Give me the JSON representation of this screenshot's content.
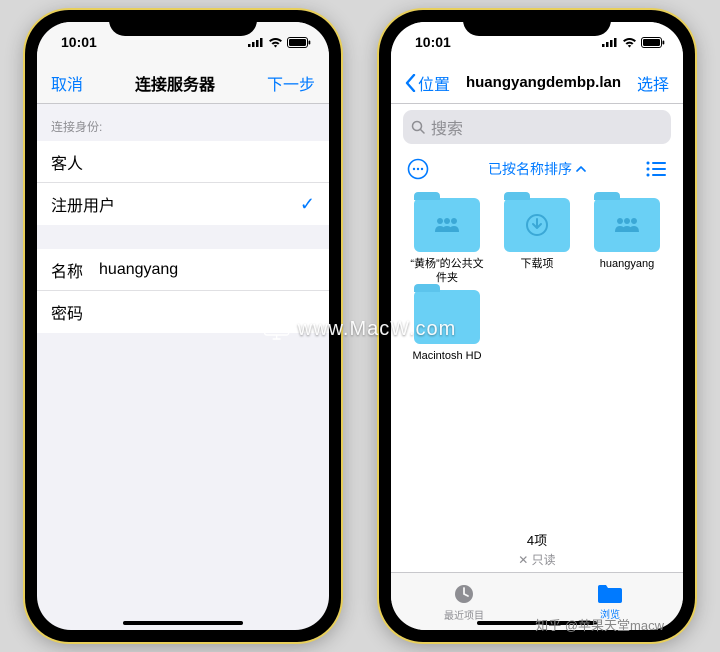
{
  "status": {
    "time": "10:01",
    "arrow": "↗"
  },
  "left": {
    "nav": {
      "cancel": "取消",
      "title": "连接服务器",
      "next": "下一步"
    },
    "sectionHeader": "连接身份:",
    "rows": {
      "guest": "客人",
      "registered": "注册用户",
      "nameLabel": "名称",
      "nameValue": "huangyang",
      "passwordLabel": "密码"
    }
  },
  "right": {
    "nav": {
      "back": "位置",
      "title": "huangyangdembp.lan",
      "select": "选择"
    },
    "searchPlaceholder": "搜索",
    "sortLabel": "已按名称排序",
    "folders": [
      {
        "name": "“黄杨”的公共文件夹",
        "glyph": "people"
      },
      {
        "name": "下载项",
        "glyph": "download"
      },
      {
        "name": "huangyang",
        "glyph": "people"
      },
      {
        "name": "Macintosh HD",
        "glyph": "none"
      }
    ],
    "footer": {
      "count": "4项",
      "readonly": "✕ 只读"
    },
    "tabs": {
      "recent": "最近项目",
      "browse": "浏览"
    }
  },
  "watermark": "www.MacW.com",
  "attribution": "知乎 @苹果天堂macw"
}
